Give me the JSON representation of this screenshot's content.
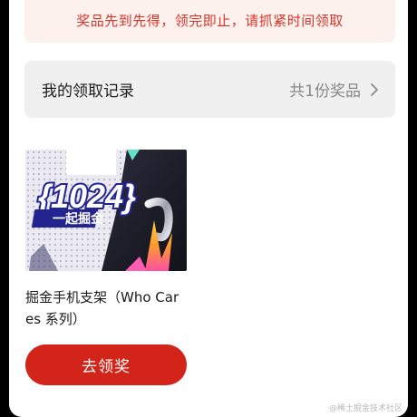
{
  "notice": {
    "text": "奖品先到先得，领完即止，请抓紧时间领取"
  },
  "records": {
    "title": "我的领取记录",
    "count_text": "共1份奖品"
  },
  "prize": {
    "image_text_top": "{1024}",
    "image_text_bottom": "一起掘金",
    "name": "掘金手机支架（Who Cares 系列）"
  },
  "action": {
    "claim_label": "去领奖"
  },
  "watermark": {
    "text": "@稀土掘金技术社区"
  },
  "colors": {
    "accent_red": "#d3241a",
    "notice_text": "#d8352a",
    "notice_bg": "#fdf1ee",
    "row_bg": "#f0f0f0"
  }
}
